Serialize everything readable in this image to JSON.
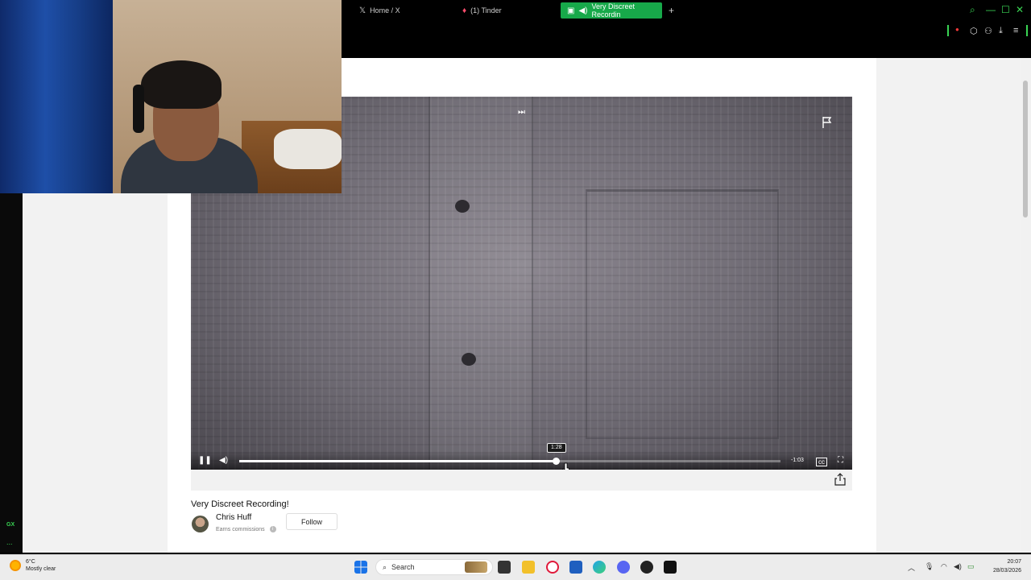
{
  "browser": {
    "tabs": [
      {
        "label": "Home / X",
        "icon": "x-logo-icon"
      },
      {
        "label": "(1) Tinder",
        "icon": "tinder-icon"
      },
      {
        "label": "Very Discreet Recordin",
        "icon": "speaker-icon",
        "active": true
      }
    ],
    "new_tab_label": "+"
  },
  "video": {
    "title": "Very Discreet Recording!",
    "current_time_tooltip": "1:28",
    "remaining_time": "-1:03",
    "progress_fraction": 0.585
  },
  "channel": {
    "author": "Chris Huff",
    "earns_text": "Earns commissions",
    "follow_label": "Follow"
  },
  "taskbar": {
    "weather_temp": "6°C",
    "weather_desc": "Mostly clear",
    "search_label": "Search",
    "time": "20:07",
    "date": "28/03/2026"
  },
  "sidebar": {
    "gx_label": "GX",
    "more_label": "..."
  },
  "colors": {
    "accent": "#39d353",
    "active_tab": "#17a94a"
  }
}
